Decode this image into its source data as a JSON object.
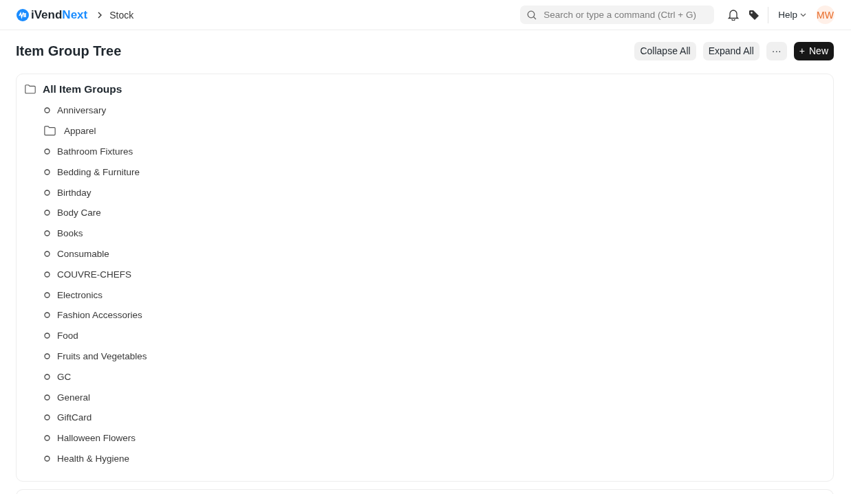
{
  "brand": {
    "name": "iVend",
    "suffix": "Next"
  },
  "breadcrumbs": [
    "Stock"
  ],
  "search": {
    "placeholder": "Search or type a command (Ctrl + G)"
  },
  "help": {
    "label": "Help"
  },
  "avatar": {
    "initials": "MW"
  },
  "page": {
    "title": "Item Group Tree"
  },
  "actions": [
    {
      "kind": "secondary",
      "label": "Collapse All"
    },
    {
      "kind": "secondary",
      "label": "Expand All"
    },
    {
      "kind": "menu",
      "label": "···"
    },
    {
      "kind": "primary",
      "icon": "+",
      "label": "New"
    }
  ],
  "tree": {
    "root": "All Item Groups",
    "children": [
      {
        "kind": "leaf",
        "label": "Anniversary"
      },
      {
        "kind": "group",
        "label": "Apparel"
      },
      {
        "kind": "leaf",
        "label": "Bathroom Fixtures"
      },
      {
        "kind": "leaf",
        "label": "Bedding & Furniture"
      },
      {
        "kind": "leaf",
        "label": "Birthday"
      },
      {
        "kind": "leaf",
        "label": "Body Care"
      },
      {
        "kind": "leaf",
        "label": "Books"
      },
      {
        "kind": "leaf",
        "label": "Consumable"
      },
      {
        "kind": "leaf",
        "label": "COUVRE-CHEFS"
      },
      {
        "kind": "leaf",
        "label": "Electronics"
      },
      {
        "kind": "leaf",
        "label": "Fashion Accessories"
      },
      {
        "kind": "leaf",
        "label": "Food"
      },
      {
        "kind": "leaf",
        "label": "Fruits and Vegetables"
      },
      {
        "kind": "leaf",
        "label": "GC"
      },
      {
        "kind": "leaf",
        "label": "General"
      },
      {
        "kind": "leaf",
        "label": "GiftCard"
      },
      {
        "kind": "leaf",
        "label": "Halloween Flowers"
      },
      {
        "kind": "leaf",
        "label": "Health & Hygiene"
      }
    ]
  }
}
